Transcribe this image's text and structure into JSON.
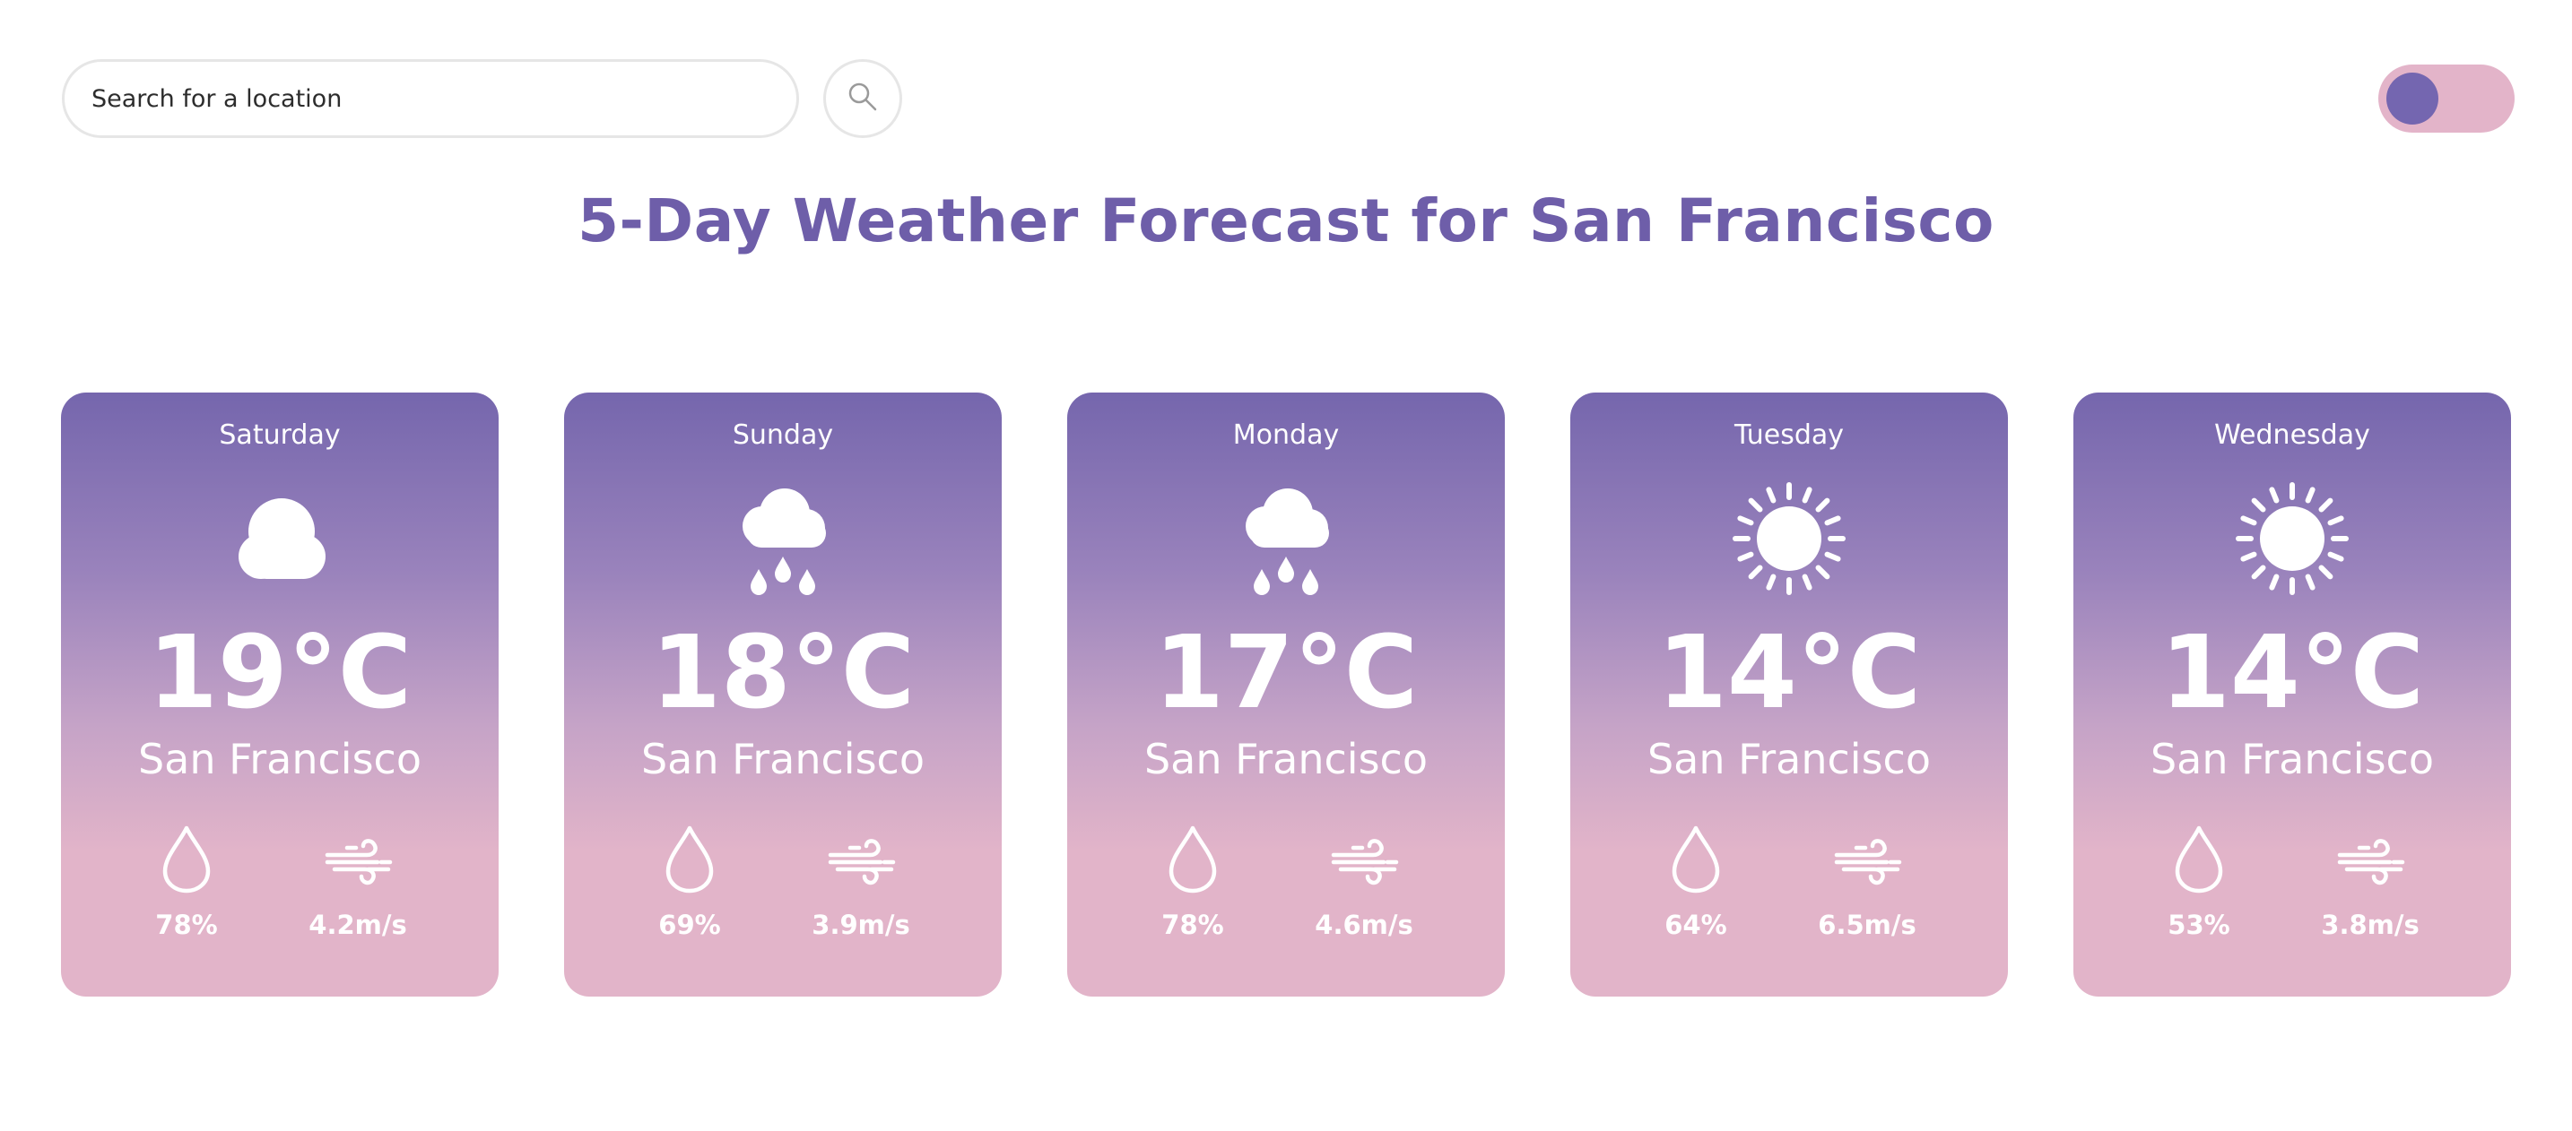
{
  "search": {
    "placeholder": "Search for a location"
  },
  "search_button": {
    "icon": "search-icon"
  },
  "theme_toggle": {
    "icon": "toggle-switch",
    "track_color": "#e3b4c9",
    "knob_color": "#7466b0"
  },
  "title": "5-Day Weather Forecast for San Francisco",
  "colors": {
    "title": "#6e5ea9",
    "card_top": "#7566ad",
    "card_bottom": "#e2b4c9",
    "text_on_card": "#ffffff"
  },
  "forecast": [
    {
      "day": "Saturday",
      "icon": "cloud-icon",
      "temp": "19°C",
      "city": "San Francisco",
      "humidity": "78%",
      "wind": "4.2m/s"
    },
    {
      "day": "Sunday",
      "icon": "rain-icon",
      "temp": "18°C",
      "city": "San Francisco",
      "humidity": "69%",
      "wind": "3.9m/s"
    },
    {
      "day": "Monday",
      "icon": "rain-icon",
      "temp": "17°C",
      "city": "San Francisco",
      "humidity": "78%",
      "wind": "4.6m/s"
    },
    {
      "day": "Tuesday",
      "icon": "sun-icon",
      "temp": "14°C",
      "city": "San Francisco",
      "humidity": "64%",
      "wind": "6.5m/s"
    },
    {
      "day": "Wednesday",
      "icon": "sun-icon",
      "temp": "14°C",
      "city": "San Francisco",
      "humidity": "53%",
      "wind": "3.8m/s"
    }
  ]
}
